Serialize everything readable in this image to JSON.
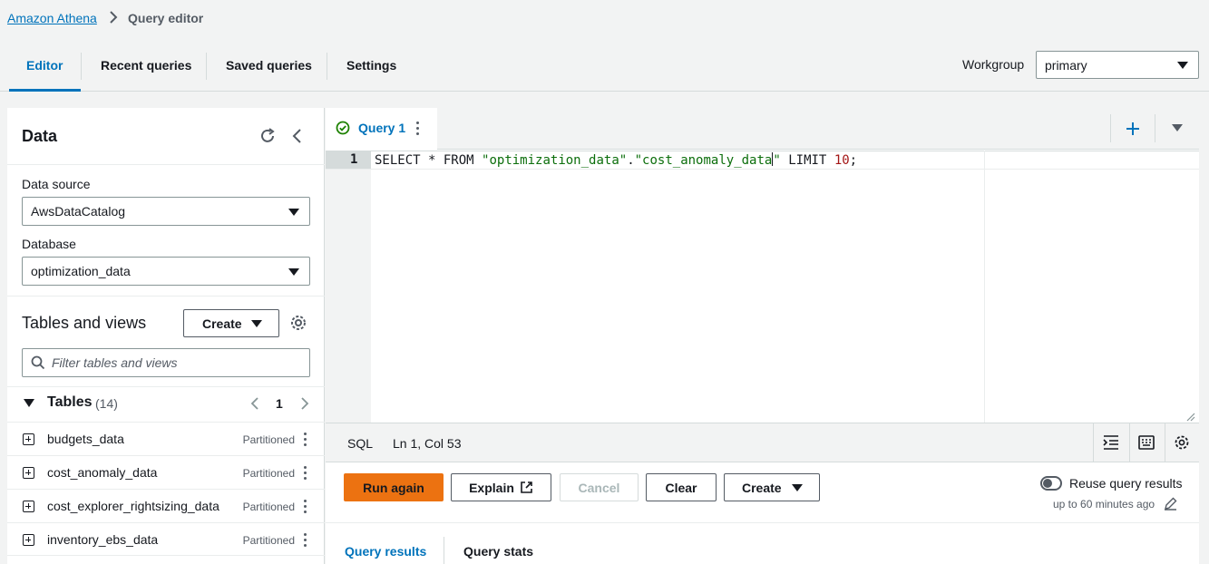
{
  "breadcrumb": {
    "root": "Amazon Athena",
    "current": "Query editor"
  },
  "tabs": [
    "Editor",
    "Recent queries",
    "Saved queries",
    "Settings"
  ],
  "workgroup": {
    "label": "Workgroup",
    "value": "primary"
  },
  "data_panel": {
    "title": "Data",
    "data_source_label": "Data source",
    "data_source_value": "AwsDataCatalog",
    "database_label": "Database",
    "database_value": "optimization_data",
    "tables_views_title": "Tables and views",
    "create_label": "Create",
    "filter_placeholder": "Filter tables and views",
    "tables_label": "Tables",
    "tables_count": "(14)",
    "page": "1",
    "tables": [
      {
        "name": "budgets_data",
        "badge": "Partitioned"
      },
      {
        "name": "cost_anomaly_data",
        "badge": "Partitioned"
      },
      {
        "name": "cost_explorer_rightsizing_data",
        "badge": "Partitioned"
      },
      {
        "name": "inventory_ebs_data",
        "badge": "Partitioned"
      }
    ]
  },
  "editor": {
    "query_tab": "Query 1",
    "line_number": "1",
    "code": {
      "kw1": "SELECT",
      "star": " * ",
      "kw2": "FROM",
      "sp": " ",
      "db": "\"optimization_data\"",
      "dot": ".",
      "tbl_a": "\"cost_anomaly_data",
      "tbl_b": "\"",
      "sp2": " ",
      "kw3": "LIMIT",
      "sp3": " ",
      "num": "10",
      "semi": ";"
    },
    "status_lang": "SQL",
    "status_pos": "Ln 1, Col 53"
  },
  "actions": {
    "run_again": "Run again",
    "explain": "Explain",
    "cancel": "Cancel",
    "clear": "Clear",
    "create": "Create",
    "reuse_label": "Reuse query results",
    "reuse_sub": "up to 60 minutes ago"
  },
  "results_tabs": [
    "Query results",
    "Query stats"
  ],
  "colors": {
    "accent": "#0073bb",
    "orange": "#ec7211",
    "green": "#1d8102"
  }
}
